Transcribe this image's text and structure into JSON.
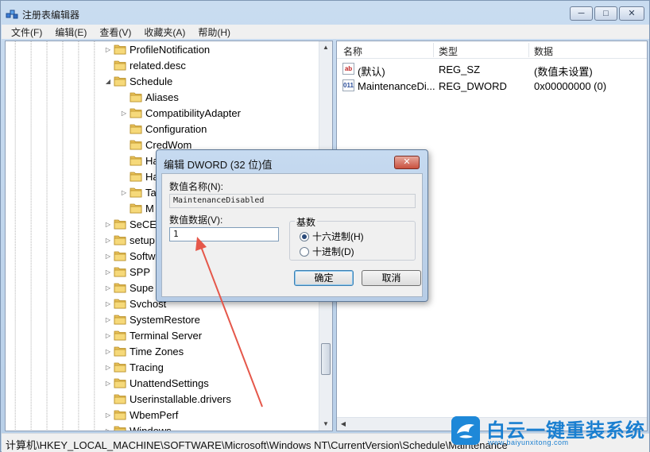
{
  "window": {
    "title": "注册表编辑器",
    "minimize": "─",
    "maximize": "□",
    "close": "✕"
  },
  "menu": [
    "文件(F)",
    "编辑(E)",
    "查看(V)",
    "收藏夹(A)",
    "帮助(H)"
  ],
  "tree": {
    "items": [
      {
        "label": "ProfileNotification",
        "expander": "collapsed"
      },
      {
        "label": "related.desc",
        "expander": "none"
      },
      {
        "label": "Schedule",
        "expander": "expanded"
      },
      {
        "label": "Aliases",
        "expander": "none"
      },
      {
        "label": "CompatibilityAdapter",
        "expander": "collapsed"
      },
      {
        "label": "Configuration",
        "expander": "none"
      },
      {
        "label": "CredWom",
        "expander": "none"
      },
      {
        "label": "Ha",
        "expander": "none"
      },
      {
        "label": "Ha",
        "expander": "none"
      },
      {
        "label": "Ta",
        "expander": "collapsed"
      },
      {
        "label": "M",
        "expander": "none"
      },
      {
        "label": "SeCE",
        "expander": "collapsed"
      },
      {
        "label": "setup",
        "expander": "collapsed"
      },
      {
        "label": "Softw",
        "expander": "collapsed"
      },
      {
        "label": "SPP",
        "expander": "collapsed"
      },
      {
        "label": "Supe",
        "expander": "collapsed"
      },
      {
        "label": "Svchost",
        "expander": "collapsed"
      },
      {
        "label": "SystemRestore",
        "expander": "collapsed"
      },
      {
        "label": "Terminal Server",
        "expander": "collapsed"
      },
      {
        "label": "Time Zones",
        "expander": "collapsed"
      },
      {
        "label": "Tracing",
        "expander": "collapsed"
      },
      {
        "label": "UnattendSettings",
        "expander": "collapsed"
      },
      {
        "label": "Userinstallable.drivers",
        "expander": "none"
      },
      {
        "label": "WbemPerf",
        "expander": "collapsed"
      },
      {
        "label": "Windows",
        "expander": "collapsed"
      }
    ]
  },
  "list": {
    "headers": {
      "name": "名称",
      "type": "类型",
      "data": "数据"
    },
    "rows": [
      {
        "icon": "ab",
        "name": "(默认)",
        "type": "REG_SZ",
        "data": "(数值未设置)"
      },
      {
        "icon": "011",
        "name": "MaintenanceDi...",
        "type": "REG_DWORD",
        "data": "0x00000000 (0)"
      }
    ]
  },
  "status": {
    "path": "计算机\\HKEY_LOCAL_MACHINE\\SOFTWARE\\Microsoft\\Windows NT\\CurrentVersion\\Schedule\\Maintenance"
  },
  "dialog": {
    "title": "编辑 DWORD (32 位)值",
    "close": "✕",
    "name_label": "数值名称(N):",
    "name_value": "MaintenanceDisabled",
    "data_label": "数值数据(V):",
    "data_value": "1",
    "base_legend": "基数",
    "radio_hex": "十六进制(H)",
    "radio_dec": "十进制(D)",
    "selected_base": "hex",
    "ok": "确定",
    "cancel": "取消"
  },
  "watermark": {
    "big": "白云一键重装系统",
    "small": "www.baiyunxitong.com"
  },
  "colors": {
    "arrow": "#e5574a",
    "watermark": "#1a7fd0"
  }
}
